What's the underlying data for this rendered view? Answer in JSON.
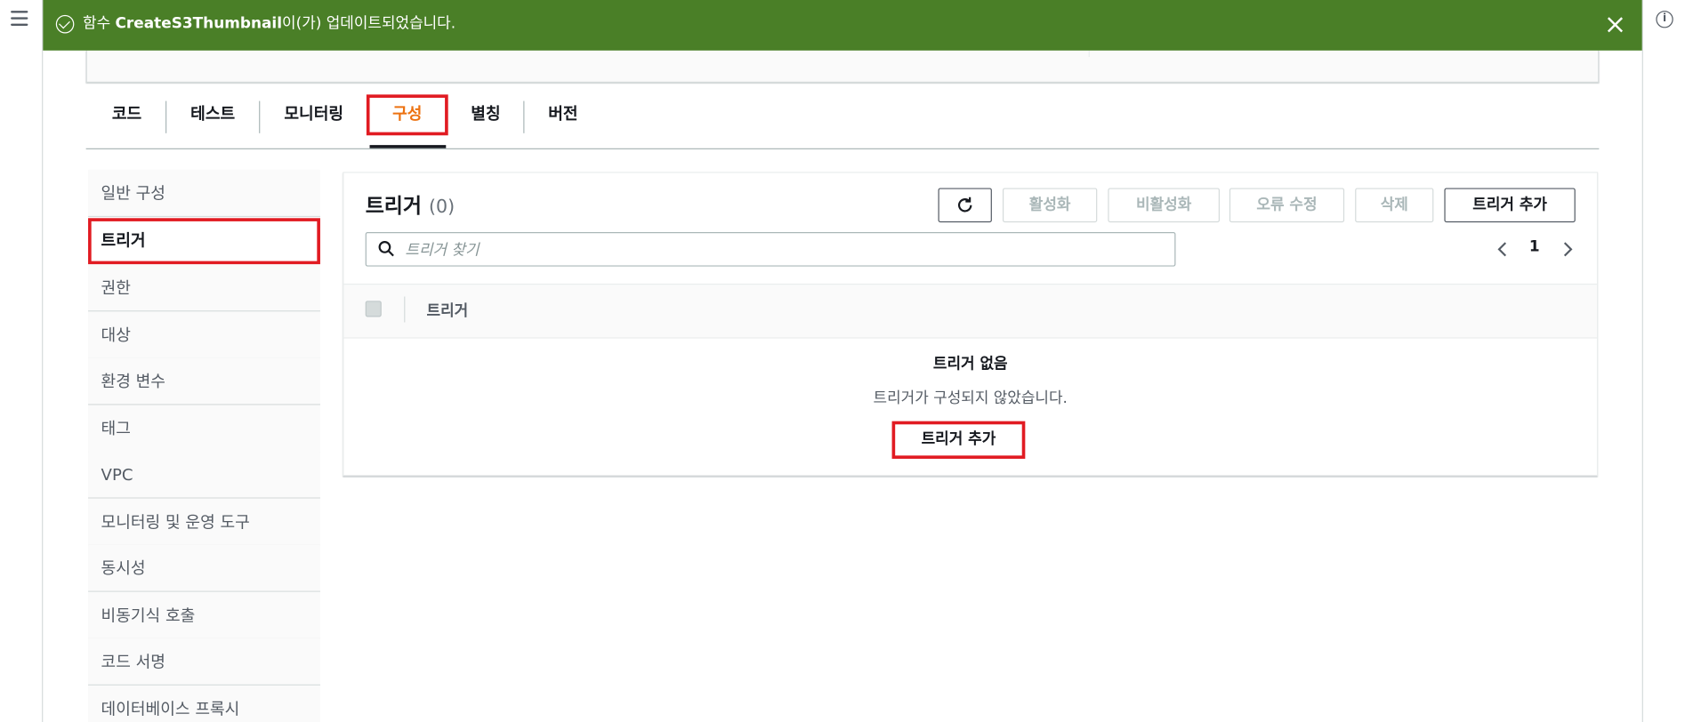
{
  "banner": {
    "prefix": "함수 ",
    "function_name": "CreateS3Thumbnail",
    "suffix": "이(가) 업데이트되었습니다."
  },
  "tabs": [
    {
      "label": "코드"
    },
    {
      "label": "테스트"
    },
    {
      "label": "모니터링"
    },
    {
      "label": "구성"
    },
    {
      "label": "별칭"
    },
    {
      "label": "버전"
    }
  ],
  "sidenav": [
    {
      "label": "일반 구성"
    },
    {
      "label": "트리거"
    },
    {
      "label": "권한"
    },
    {
      "label": "대상"
    },
    {
      "label": "환경 변수"
    },
    {
      "label": "태그"
    },
    {
      "label": "VPC"
    },
    {
      "label": "모니터링 및 운영 도구"
    },
    {
      "label": "동시성"
    },
    {
      "label": "비동기식 호출"
    },
    {
      "label": "코드 서명"
    },
    {
      "label": "데이터베이스 프록시"
    }
  ],
  "panel": {
    "title": "트리거",
    "count": "(0)",
    "actions": {
      "activate": "활성화",
      "deactivate": "비활성화",
      "fix_errors": "오류 수정",
      "delete": "삭제",
      "add_trigger": "트리거 추가"
    },
    "search_placeholder": "트리거 찾기",
    "page": "1",
    "column_header": "트리거",
    "empty_title": "트리거 없음",
    "empty_message": "트리거가 구성되지 않았습니다.",
    "empty_button": "트리거 추가"
  },
  "colors": {
    "banner_bg": "#4a7f27",
    "active_tab": "#ec7211",
    "highlight_box": "#e11b22"
  }
}
